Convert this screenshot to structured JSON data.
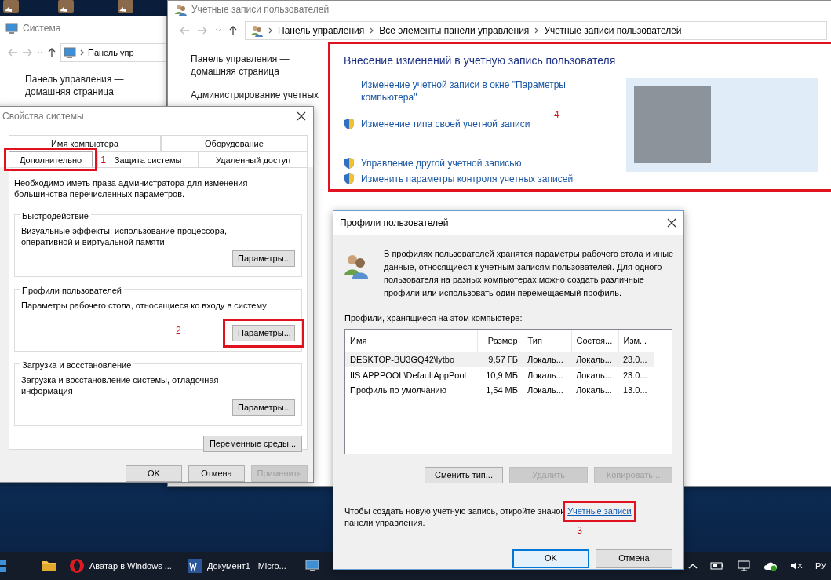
{
  "system_window": {
    "title": "Система",
    "breadcrumb": [
      "Панель упр"
    ],
    "sidebar_links": [
      "Панель управления — домашняя страница"
    ]
  },
  "accounts_window": {
    "title": "Учетные записи пользователей",
    "breadcrumb": [
      "Панель управления",
      "Все элементы панели управления",
      "Учетные записи пользователей"
    ],
    "sidebar_links": [
      "Панель управления — домашняя страница",
      "Администрирование учетных"
    ],
    "heading": "Внесение изменений в учетную запись пользователя",
    "tasks": [
      {
        "label": "Изменение учетной записи в окне \"Параметры компьютера\"",
        "shield": false
      },
      {
        "label": "Изменение типа своей учетной записи",
        "shield": true
      },
      {
        "label": "Управление другой учетной записью",
        "shield": true
      },
      {
        "label": "Изменить параметры контроля учетных записей",
        "shield": true
      }
    ]
  },
  "system_properties": {
    "title": "Свойства системы",
    "tab_rows": [
      [
        {
          "label": "Имя компьютера",
          "selected": false
        },
        {
          "label": "Оборудование",
          "selected": false
        }
      ],
      [
        {
          "label": "Дополнительно",
          "selected": true
        },
        {
          "label": "Защита системы",
          "selected": false
        },
        {
          "label": "Удаленный доступ",
          "selected": false
        }
      ]
    ],
    "note": "Необходимо иметь права администратора для изменения большинства перечисленных параметров.",
    "groups": [
      {
        "title": "Быстродействие",
        "text": "Визуальные эффекты, использование процессора, оперативной и виртуальной памяти",
        "button": "Параметры..."
      },
      {
        "title": "Профили пользователей",
        "text": "Параметры рабочего стола, относящиеся ко входу в систему",
        "button": "Параметры..."
      },
      {
        "title": "Загрузка и восстановление",
        "text": "Загрузка и восстановление системы, отладочная информация",
        "button": "Параметры..."
      }
    ],
    "env_button": "Переменные среды...",
    "buttons": [
      {
        "label": "OK",
        "disabled": false
      },
      {
        "label": "Отмена",
        "disabled": false
      },
      {
        "label": "Применить",
        "disabled": true
      }
    ]
  },
  "profiles_dialog": {
    "title": "Профили пользователей",
    "intro": "В профилях пользователей хранятся параметры рабочего стола и иные данные, относящиеся к учетным записям пользователей. Для одного пользователя на разных компьютерах можно создать различные профили или использовать один перемещаемый профиль.",
    "list_label": "Профили, хранящиеся на этом компьютере:",
    "table": {
      "columns": [
        "Имя",
        "Размер",
        "Тип",
        "Состоя...",
        "Изм..."
      ],
      "rows": [
        {
          "cells": [
            "DESKTOP-BU3GQ42\\lytbo",
            "9,57 ГБ",
            "Локаль...",
            "Локаль...",
            "23.0..."
          ],
          "selected": true
        },
        {
          "cells": [
            "IIS APPPOOL\\DefaultAppPool",
            "10,9 МБ",
            "Локаль...",
            "Локаль...",
            "23.0..."
          ],
          "selected": false
        },
        {
          "cells": [
            "Профиль по умолчанию",
            "1,54 МБ",
            "Локаль...",
            "Локаль...",
            "13.0..."
          ],
          "selected": false
        }
      ]
    },
    "actions": [
      {
        "label": "Сменить тип...",
        "disabled": false
      },
      {
        "label": "Удалить",
        "disabled": true
      },
      {
        "label": "Копировать...",
        "disabled": true
      }
    ],
    "footer_text": "Чтобы создать новую учетную запись, откройте значок",
    "footer_link": "Учетные записи",
    "footer_text_end": "панели управления.",
    "buttons": [
      {
        "label": "OK",
        "default": true
      },
      {
        "label": "Отмена",
        "default": false
      }
    ]
  },
  "annotations": [
    "1",
    "2",
    "3",
    "4"
  ],
  "taskbar": {
    "items": [
      {
        "kind": "start"
      },
      {
        "kind": "folder"
      },
      {
        "label": "Аватар в Windows ...",
        "kind": "opera"
      },
      {
        "label": "Документ1 - Micro...",
        "kind": "word"
      },
      {
        "kind": "monitor"
      }
    ],
    "language": "РУ"
  }
}
